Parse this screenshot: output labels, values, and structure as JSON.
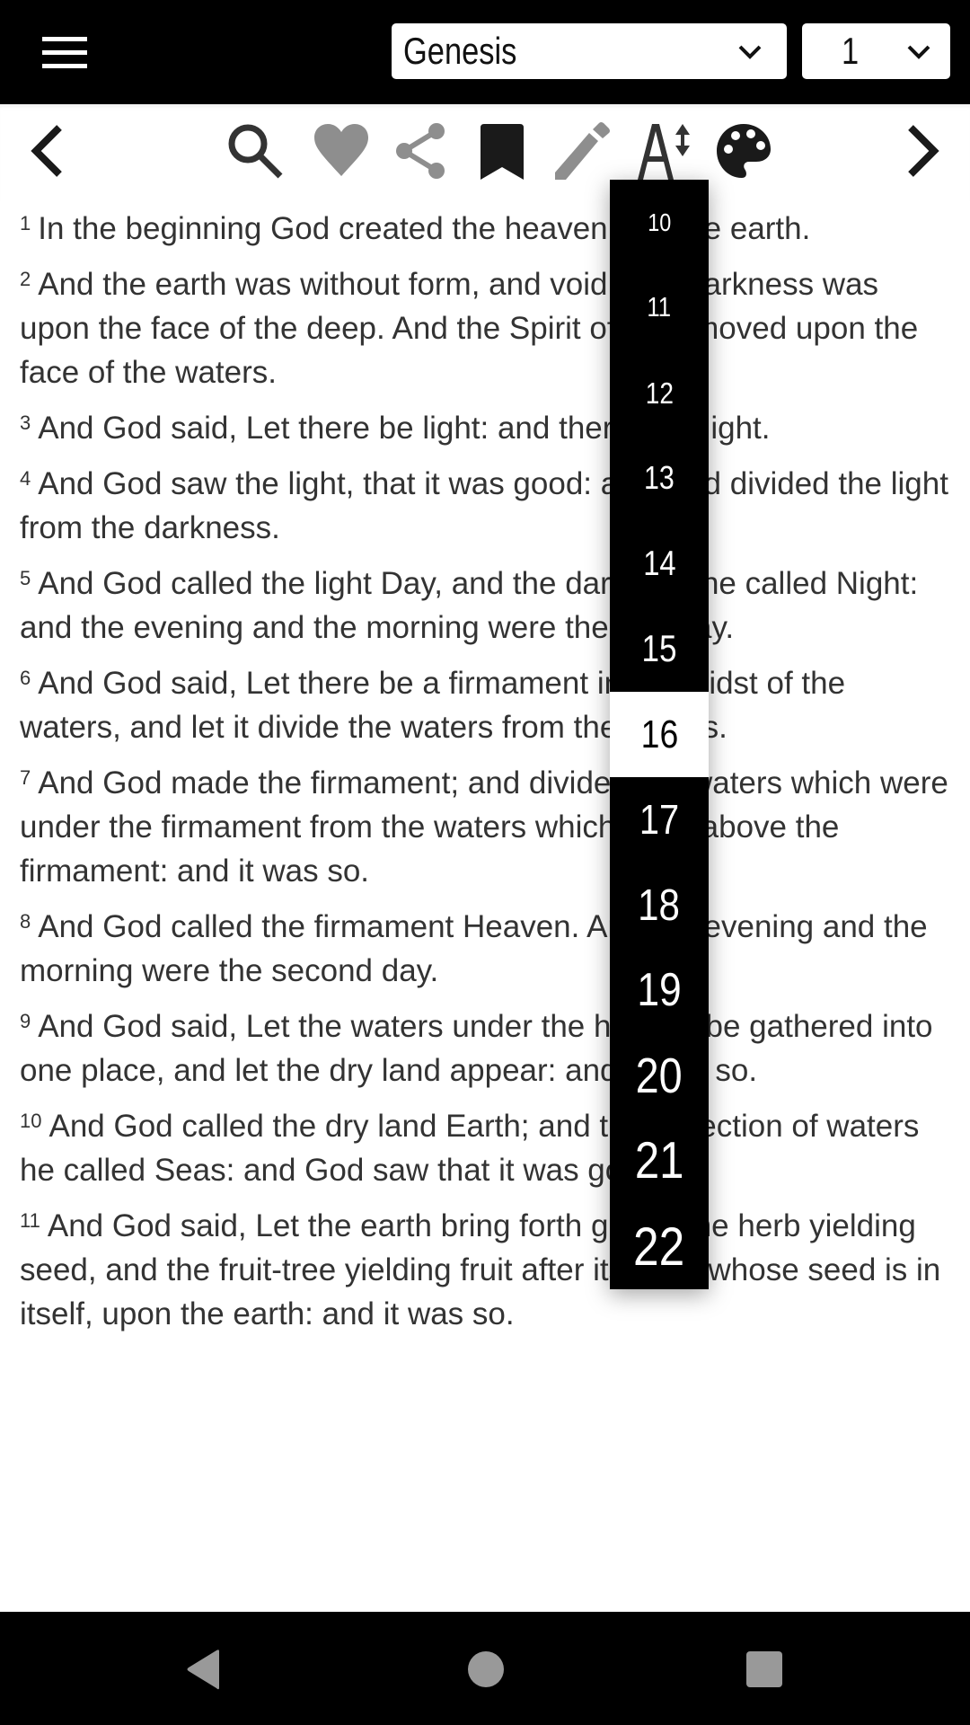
{
  "header": {
    "menu_icon": "hamburger-menu-icon",
    "book_select": {
      "value": "Genesis",
      "icon": "chevron-down-icon"
    },
    "chapter_select": {
      "value": "1",
      "icon": "chevron-down-icon"
    }
  },
  "toolbar": {
    "items": [
      {
        "name": "previous-chapter",
        "icon": "chevron-left-icon"
      },
      {
        "name": "search",
        "icon": "search-icon",
        "color": "#333333"
      },
      {
        "name": "favorite",
        "icon": "heart-icon",
        "color": "#8e8e8e"
      },
      {
        "name": "share",
        "icon": "share-icon",
        "color": "#8e8e8e"
      },
      {
        "name": "bookmark",
        "icon": "bookmark-icon",
        "color": "#1a1a1a"
      },
      {
        "name": "note",
        "icon": "pencil-icon",
        "color": "#8e8e8e"
      },
      {
        "name": "font-size",
        "icon": "font-size-icon",
        "color": "#333333"
      },
      {
        "name": "theme",
        "icon": "palette-icon",
        "color": "#1a1a1a"
      },
      {
        "name": "next-chapter",
        "icon": "chevron-right-icon"
      }
    ]
  },
  "font_size_menu": {
    "options": [
      "10",
      "11",
      "12",
      "13",
      "14",
      "15",
      "16",
      "17",
      "18",
      "19",
      "20",
      "21",
      "22"
    ],
    "selected": "16"
  },
  "verses": [
    {
      "num": "1",
      "text": "In the beginning God created the heaven and the earth."
    },
    {
      "num": "2",
      "text": "And the earth was without form, and void; and darkness was upon the face of the deep. And the Spirit of God moved upon the face of the waters."
    },
    {
      "num": "3",
      "text": "And God said, Let there be light: and there was light."
    },
    {
      "num": "4",
      "text": "And God saw the light, that it was good: and God divided the light from the darkness."
    },
    {
      "num": "5",
      "text": "And God called the light Day, and the darkness he called Night: and the evening and the morning were the first day."
    },
    {
      "num": "6",
      "text": "And God said, Let there be a firmament in the midst of the waters, and let it divide the waters from the waters."
    },
    {
      "num": "7",
      "text": "And God made the firmament; and divided the waters which were under the firmament from the waters which were above the firmament: and it was so."
    },
    {
      "num": "8",
      "text": "And God called the firmament Heaven. And the evening and the morning were the second day."
    },
    {
      "num": "9",
      "text": "And God said, Let the waters under the heaven be gathered into one place, and let the dry land appear: and it was so."
    },
    {
      "num": "10",
      "text": "And God called the dry land Earth; and the collection of waters he called Seas: and God saw that it was good."
    },
    {
      "num": "11",
      "text": "And God said, Let the earth bring forth grass, the herb yielding seed, and the fruit-tree yielding fruit after its kind, whose seed is in itself, upon the earth: and it was so."
    }
  ],
  "system_nav": {
    "back": "back-triangle-icon",
    "home": "home-circle-icon",
    "recents": "recents-square-icon"
  }
}
